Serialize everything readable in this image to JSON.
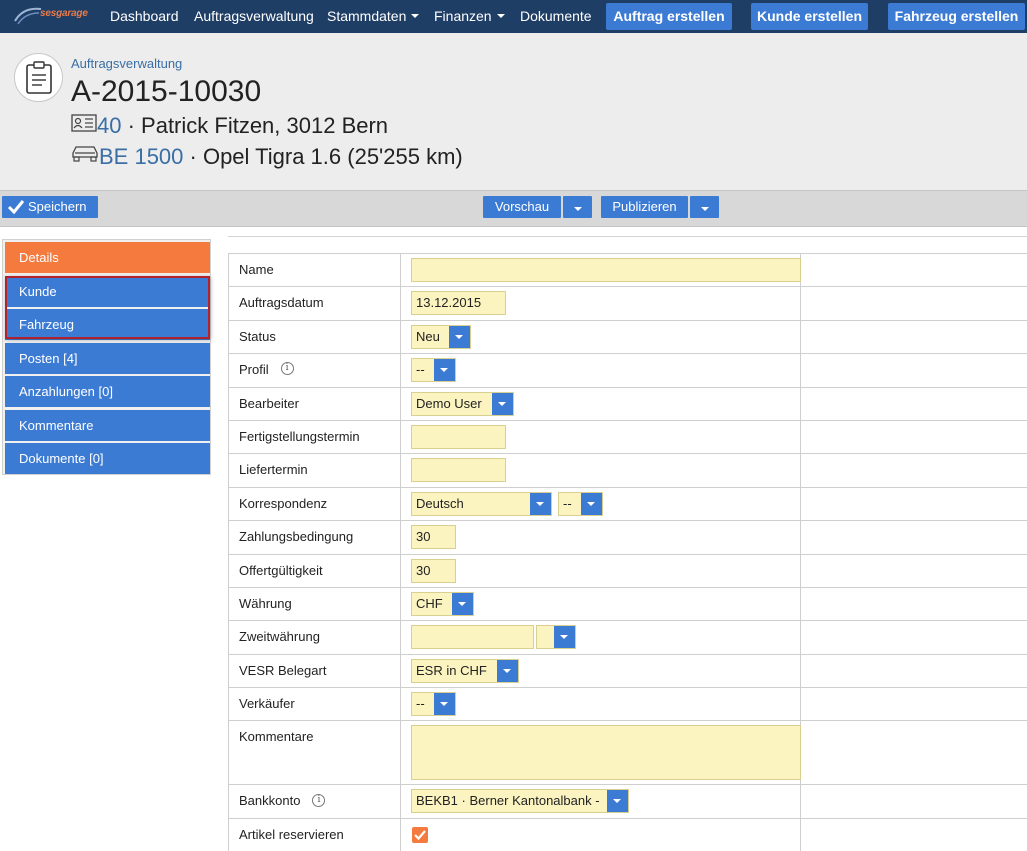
{
  "nav": {
    "brand": "sesgarage",
    "items": [
      {
        "label": "Dashboard",
        "caret": false
      },
      {
        "label": "Auftragsverwaltung",
        "caret": false
      },
      {
        "label": "Stammdaten",
        "caret": true
      },
      {
        "label": "Finanzen",
        "caret": true
      },
      {
        "label": "Dokumente",
        "caret": false
      }
    ],
    "buttons": [
      "Auftrag erstellen",
      "Kunde erstellen",
      "Fahrzeug erstellen"
    ]
  },
  "header": {
    "breadcrumb": "Auftragsverwaltung",
    "title": "A-2015-10030",
    "customer_number": "40",
    "customer_text": " · Patrick Fitzen, 3012 Bern",
    "vehicle_plate": "BE 1500",
    "vehicle_text": " · Opel Tigra 1.6 (25'255 km)"
  },
  "toolbar": {
    "save_label": "Speichern",
    "preview_label": "Vorschau",
    "publish_label": "Publizieren"
  },
  "sidebar": {
    "items": [
      {
        "label": "Details",
        "active": true
      },
      {
        "label": "Kunde",
        "active": false
      },
      {
        "label": "Fahrzeug",
        "active": false
      },
      {
        "label": "Posten [4]",
        "active": false
      },
      {
        "label": "Anzahlungen [0]",
        "active": false
      },
      {
        "label": "Kommentare",
        "active": false
      },
      {
        "label": "Dokumente [0]",
        "active": false
      }
    ]
  },
  "form": {
    "name_label": "Name",
    "name_value": "",
    "auftragsdatum_label": "Auftragsdatum",
    "auftragsdatum_value": "13.12.2015",
    "status_label": "Status",
    "status_value": "Neu",
    "profil_label": "Profil",
    "profil_value": "--",
    "bearbeiter_label": "Bearbeiter",
    "bearbeiter_value": "Demo User",
    "fertigstellung_label": "Fertigstellungstermin",
    "fertigstellung_value": "",
    "liefertermin_label": "Liefertermin",
    "liefertermin_value": "",
    "korrespondenz_label": "Korrespondenz",
    "korrespondenz_value": "Deutsch",
    "korrespondenz_sub_value": "--",
    "zahlungsbedingung_label": "Zahlungsbedingung",
    "zahlungsbedingung_value": "30",
    "offertgueltigkeit_label": "Offertgültigkeit",
    "offertgueltigkeit_value": "30",
    "waehrung_label": "Währung",
    "waehrung_value": "CHF",
    "zweitwaehrung_label": "Zweitwährung",
    "zweitwaehrung_value": "",
    "zweitwaehrung_select_value": "",
    "vesr_label": "VESR Belegart",
    "vesr_value": "ESR in CHF",
    "verkaeufer_label": "Verkäufer",
    "verkaeufer_value": "--",
    "kommentare_label": "Kommentare",
    "kommentare_value": "",
    "bankkonto_label": "Bankkonto",
    "bankkonto_value": "BEKB1 · Berner Kantonalbank -",
    "artikel_label": "Artikel reservieren",
    "artikel_checked": true
  },
  "colors": {
    "navbar": "#1f3e66",
    "accent_blue": "#3c7bd4",
    "active_orange": "#f47a3e",
    "input_yellow": "#fcf4c0",
    "highlight_red": "#b1212e"
  }
}
